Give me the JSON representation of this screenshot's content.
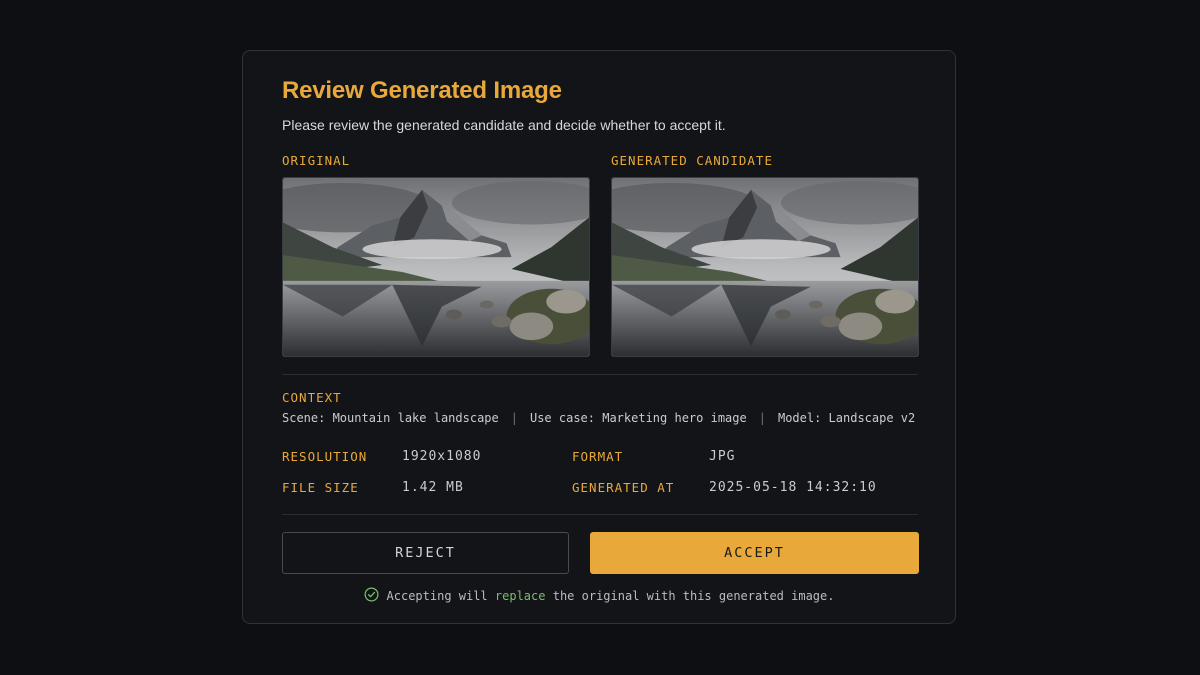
{
  "dialog": {
    "title": "Review Generated Image",
    "subtitle": "Please review the generated candidate and decide whether to accept it."
  },
  "images": {
    "original_label": "ORIGINAL",
    "candidate_label": "GENERATED CANDIDATE"
  },
  "context": {
    "label": "CONTEXT",
    "scene": "Scene: Mountain lake landscape",
    "use_case": "Use case: Marketing hero image",
    "model": "Model: Landscape v2",
    "separator": "|"
  },
  "meta": {
    "resolution_key": "RESOLUTION",
    "resolution_val": "1920x1080",
    "format_key": "FORMAT",
    "format_val": "JPG",
    "filesize_key": "FILE SIZE",
    "filesize_val": "1.42 MB",
    "generated_key": "GENERATED AT",
    "generated_val": "2025-05-18 14:32:10"
  },
  "actions": {
    "reject_label": "REJECT",
    "accept_label": "ACCEPT"
  },
  "notice": {
    "prefix": "Accepting will",
    "highlight": "replace",
    "suffix": "the original with this generated image.",
    "icon": "check-circle-icon"
  },
  "colors": {
    "accent": "#e9a93a",
    "background": "#0e0f13",
    "panel": "#121418",
    "success": "#7bbf6a"
  }
}
